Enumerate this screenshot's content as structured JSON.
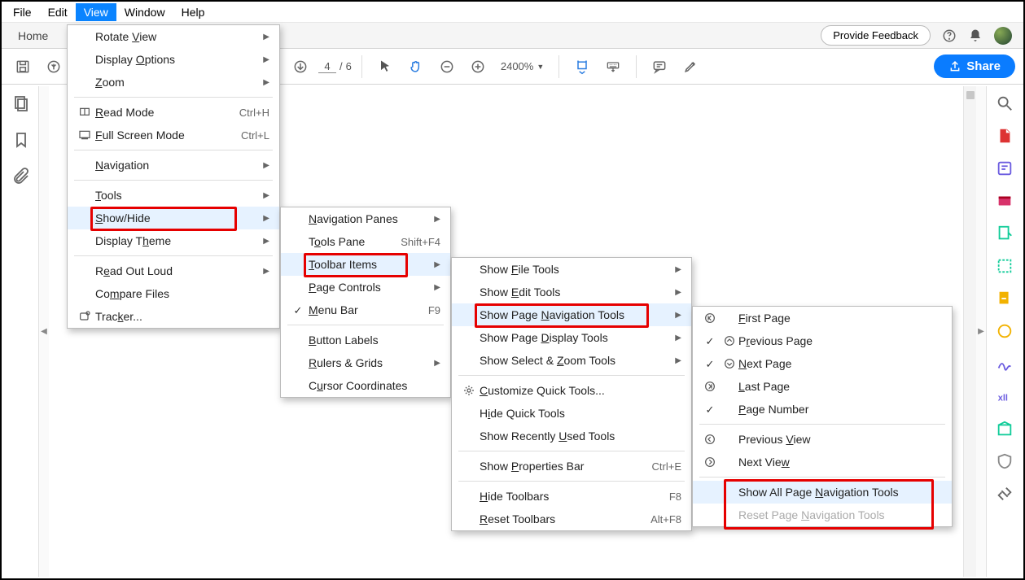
{
  "menubar": {
    "items": [
      "File",
      "Edit",
      "View",
      "Window",
      "Help"
    ],
    "active_index": 2
  },
  "tabbar": {
    "home": "Home",
    "feedback": "Provide Feedback"
  },
  "toolbar": {
    "page_current": "4",
    "page_total": "6",
    "zoom": "2400%",
    "share": "Share"
  },
  "menu1": {
    "items": [
      {
        "label": "Rotate ",
        "u": "V",
        "after": "iew",
        "arrow": true
      },
      {
        "label": "Display ",
        "u": "O",
        "after": "ptions",
        "arrow": true
      },
      {
        "label": "",
        "u": "Z",
        "after": "oom",
        "arrow": true
      },
      {
        "sep": true
      },
      {
        "icon": "read-mode",
        "label": "",
        "u": "R",
        "after": "ead Mode",
        "shortcut": "Ctrl+H"
      },
      {
        "icon": "fullscreen",
        "label": "",
        "u": "F",
        "after": "ull Screen Mode",
        "shortcut": "Ctrl+L"
      },
      {
        "sep": true
      },
      {
        "label": "",
        "u": "N",
        "after": "avigation",
        "arrow": true
      },
      {
        "sep": true
      },
      {
        "label": "",
        "u": "T",
        "after": "ools",
        "arrow": true
      },
      {
        "label": "",
        "u": "S",
        "after": "how/Hide",
        "arrow": true,
        "hovered": true,
        "redbox": true
      },
      {
        "label": "Display T",
        "u": "h",
        "after": "eme",
        "arrow": true
      },
      {
        "sep": true
      },
      {
        "label": "R",
        "u": "e",
        "after": "ad Out Loud",
        "arrow": true
      },
      {
        "label": "Co",
        "u": "m",
        "after": "pare Files"
      },
      {
        "icon": "tracker",
        "label": "Trac",
        "u": "k",
        "after": "er..."
      }
    ]
  },
  "menu2": {
    "items": [
      {
        "label": "",
        "u": "N",
        "after": "avigation Panes",
        "arrow": true
      },
      {
        "label": "T",
        "u": "o",
        "after": "ols Pane",
        "shortcut": "Shift+F4"
      },
      {
        "label": "",
        "u": "T",
        "after": "oolbar Items",
        "arrow": true,
        "hovered": true,
        "redbox": true
      },
      {
        "label": "",
        "u": "P",
        "after": "age Controls",
        "arrow": true
      },
      {
        "check": true,
        "label": "",
        "u": "M",
        "after": "enu Bar",
        "shortcut": "F9"
      },
      {
        "sep": true
      },
      {
        "label": "",
        "u": "B",
        "after": "utton Labels"
      },
      {
        "label": "",
        "u": "R",
        "after": "ulers & Grids",
        "arrow": true
      },
      {
        "label": "C",
        "u": "u",
        "after": "rsor Coordinates"
      }
    ]
  },
  "menu3": {
    "items": [
      {
        "label": "Show ",
        "u": "F",
        "after": "ile Tools",
        "arrow": true
      },
      {
        "label": "Show ",
        "u": "E",
        "after": "dit Tools",
        "arrow": true
      },
      {
        "label": "Show Page ",
        "u": "N",
        "after": "avigation Tools",
        "arrow": true,
        "hovered": true,
        "redbox": true
      },
      {
        "label": "Show Page ",
        "u": "D",
        "after": "isplay Tools",
        "arrow": true
      },
      {
        "label": "Show Select & ",
        "u": "Z",
        "after": "oom Tools",
        "arrow": true
      },
      {
        "sep": true
      },
      {
        "icon": "gear",
        "label": "",
        "u": "C",
        "after": "ustomize Quick Tools..."
      },
      {
        "label": "H",
        "u": "i",
        "after": "de Quick Tools"
      },
      {
        "label": "Show Recently ",
        "u": "U",
        "after": "sed Tools"
      },
      {
        "sep": true
      },
      {
        "label": "Show ",
        "u": "P",
        "after": "roperties Bar",
        "shortcut": "Ctrl+E"
      },
      {
        "sep": true
      },
      {
        "label": "",
        "u": "H",
        "after": "ide Toolbars",
        "shortcut": "F8"
      },
      {
        "label": "",
        "u": "R",
        "after": "eset Toolbars",
        "shortcut": "Alt+F8"
      }
    ]
  },
  "menu4": {
    "items": [
      {
        "icon": "circ-first",
        "label": "",
        "u": "F",
        "after": "irst Page"
      },
      {
        "check": true,
        "icon": "circ-up",
        "label": "P",
        "u": "r",
        "after": "evious Page"
      },
      {
        "check": true,
        "icon": "circ-down",
        "label": "",
        "u": "N",
        "after": "ext Page"
      },
      {
        "icon": "circ-last",
        "label": "",
        "u": "L",
        "after": "ast Page"
      },
      {
        "check": true,
        "label": "",
        "u": "P",
        "after": "age Number"
      },
      {
        "sep": true
      },
      {
        "icon": "circ-left",
        "label": "Previous ",
        "u": "V",
        "after": "iew"
      },
      {
        "icon": "circ-right",
        "label": "Next Vie",
        "u": "w",
        "after": ""
      },
      {
        "sep": true
      },
      {
        "label": "Show All Page ",
        "u": "N",
        "after": "avigation Tools",
        "hovered": true,
        "redbox_group_start": true
      },
      {
        "label": "Reset Page ",
        "u": "N",
        "after": "avigation Tools",
        "disabled": true,
        "redbox_group_end": true
      }
    ]
  }
}
